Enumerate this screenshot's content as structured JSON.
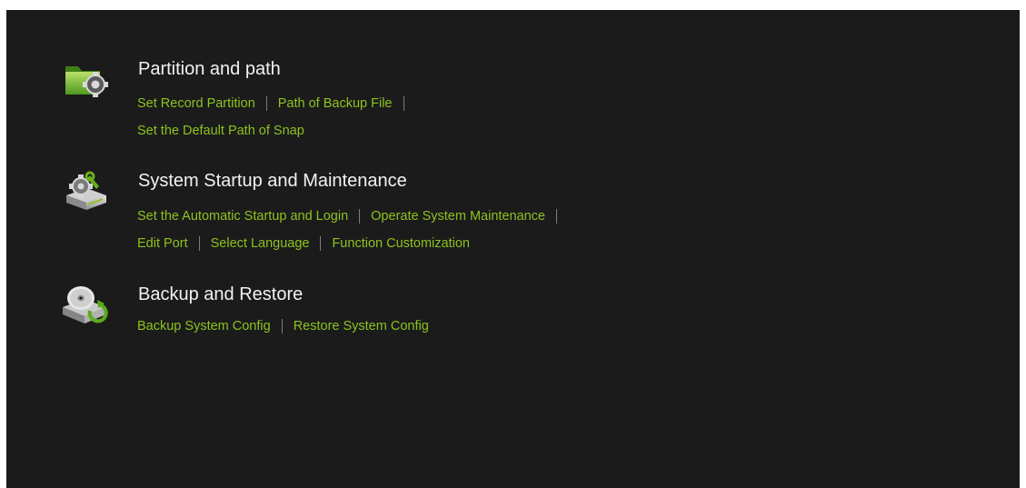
{
  "sections": [
    {
      "title": "Partition and path",
      "icon": "folder-gear-icon",
      "links": [
        [
          "Set Record Partition",
          "Path of Backup File"
        ],
        [
          "Set the Default Path of Snap"
        ]
      ]
    },
    {
      "title": "System Startup and Maintenance",
      "icon": "gear-wrench-server-icon",
      "links": [
        [
          "Set the Automatic Startup and Login",
          "Operate System Maintenance"
        ],
        [
          "Edit Port",
          "Select Language",
          "Function Customization"
        ]
      ]
    },
    {
      "title": "Backup and Restore",
      "icon": "disc-restore-icon",
      "links": [
        [
          "Backup System Config",
          "Restore System Config"
        ]
      ]
    }
  ],
  "colors": {
    "background": "#1b1b1b",
    "title": "#f2f2f2",
    "link": "#8dc21f",
    "separator": "#7d7d7d"
  }
}
